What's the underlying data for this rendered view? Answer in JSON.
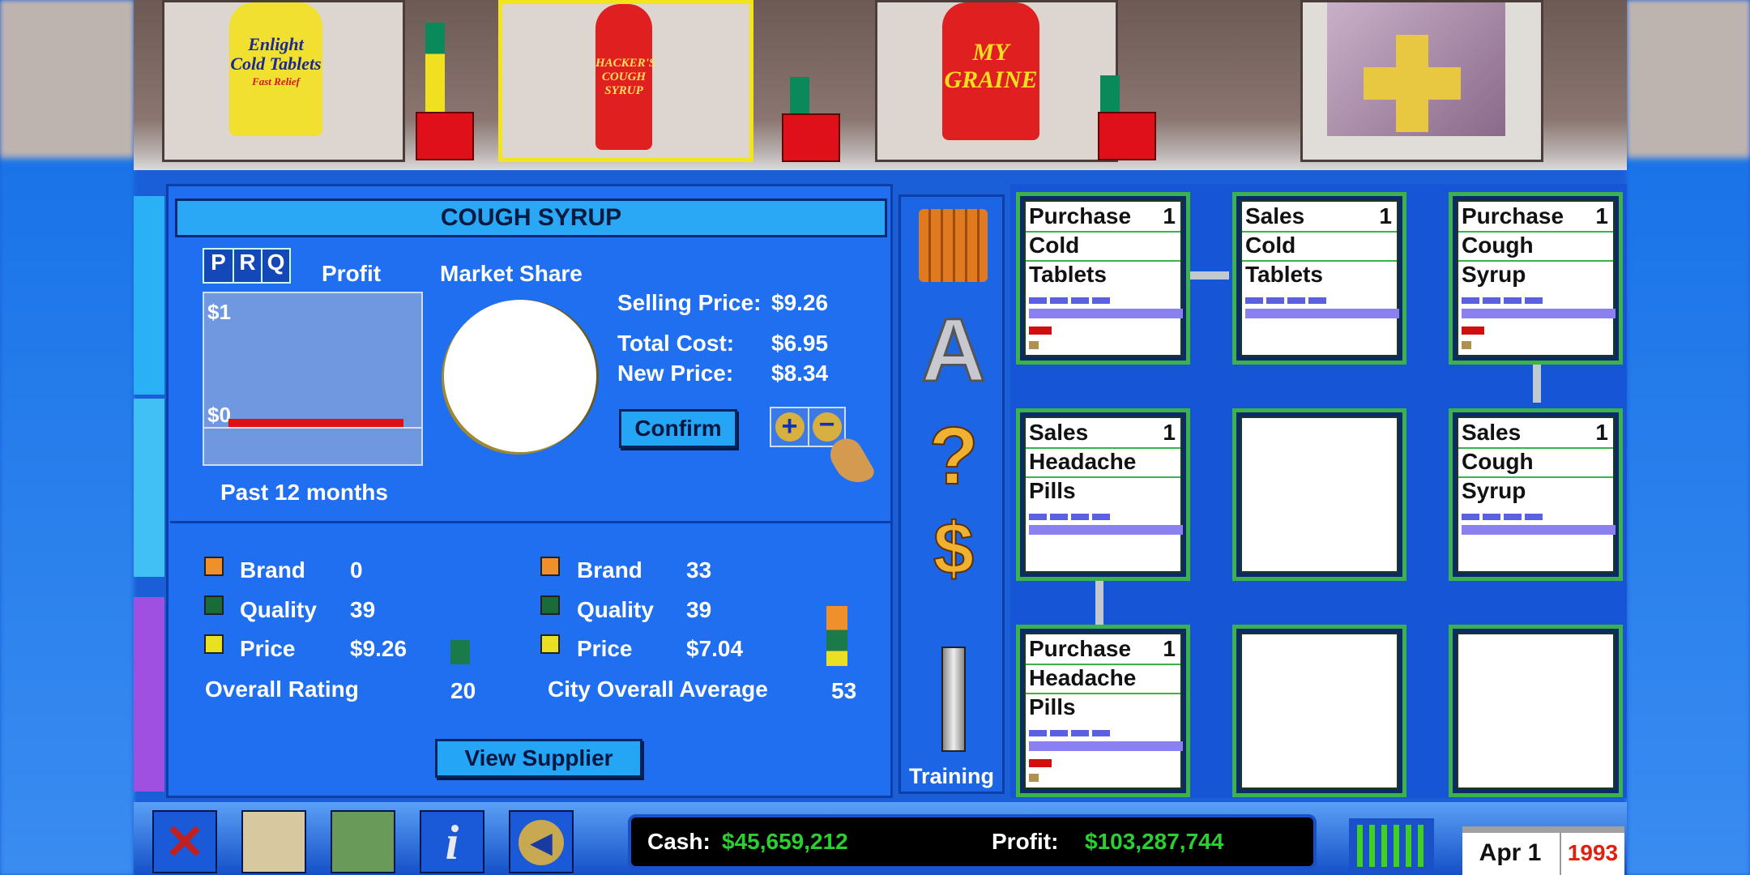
{
  "shelf": {
    "products": [
      {
        "name": "cold-tablets",
        "label": "Enlight Cold Tablets",
        "sublabel": "Fast Relief"
      },
      {
        "name": "cough-syrup",
        "label": "HACKER'S COUGH SYRUP",
        "selected": true
      },
      {
        "name": "migraine-pills",
        "label": "MY GRAINE"
      },
      {
        "name": "pharmacy-building",
        "label": ""
      }
    ]
  },
  "detail": {
    "title": "COUGH SYRUP",
    "prq": [
      "P",
      "R",
      "Q"
    ],
    "profit_label": "Profit",
    "chart_data": {
      "type": "bar",
      "title": "Profit",
      "ytick_top": "$1",
      "ytick_zero": "$0",
      "xlabel": "Past 12 months",
      "values": [
        0,
        0,
        0,
        0,
        0,
        0,
        0,
        0,
        0,
        0,
        0,
        0
      ]
    },
    "market_share_label": "Market Share",
    "market_share_percent": 0,
    "selling_price_label": "Selling Price:",
    "selling_price": "$9.26",
    "total_cost_label": "Total Cost:",
    "total_cost": "$6.95",
    "new_price_label": "New Price:",
    "new_price": "$8.34",
    "confirm": "Confirm",
    "own": {
      "brand_label": "Brand",
      "brand": "0",
      "quality_label": "Quality",
      "quality": "39",
      "price_label": "Price",
      "price": "$9.26",
      "overall_label": "Overall Rating",
      "overall": "20"
    },
    "city": {
      "brand_label": "Brand",
      "brand": "33",
      "quality_label": "Quality",
      "quality": "39",
      "price_label": "Price",
      "price": "$7.04",
      "overall_label": "City Overall Average",
      "overall": "53"
    },
    "view_supplier": "View Supplier",
    "colors": {
      "brand": "#f0902a",
      "quality": "#1a6a3a",
      "price": "#e8e020"
    }
  },
  "tools": {
    "training": "Training"
  },
  "grid": {
    "cells": [
      {
        "l1": "Purchase",
        "l2": "Cold",
        "l3": "Tablets",
        "level": "1"
      },
      {
        "l1": "Sales",
        "l2": "Cold",
        "l3": "Tablets",
        "level": "1"
      },
      {
        "l1": "Purchase",
        "l2": "Cough",
        "l3": "Syrup",
        "level": "1"
      },
      {
        "l1": "Sales",
        "l2": "Headache",
        "l3": "Pills",
        "level": "1"
      },
      {
        "l1": "",
        "l2": "",
        "l3": "",
        "level": ""
      },
      {
        "l1": "Sales",
        "l2": "Cough",
        "l3": "Syrup",
        "level": "1"
      },
      {
        "l1": "Purchase",
        "l2": "Headache",
        "l3": "Pills",
        "level": "1"
      },
      {
        "l1": "",
        "l2": "",
        "l3": "",
        "level": ""
      },
      {
        "l1": "",
        "l2": "",
        "l3": "",
        "level": ""
      }
    ]
  },
  "status": {
    "cash_label": "Cash:",
    "cash": "$45,659,212",
    "profit_label": "Profit:",
    "profit": "$103,287,744",
    "date": "Apr 1",
    "year": "1993"
  }
}
